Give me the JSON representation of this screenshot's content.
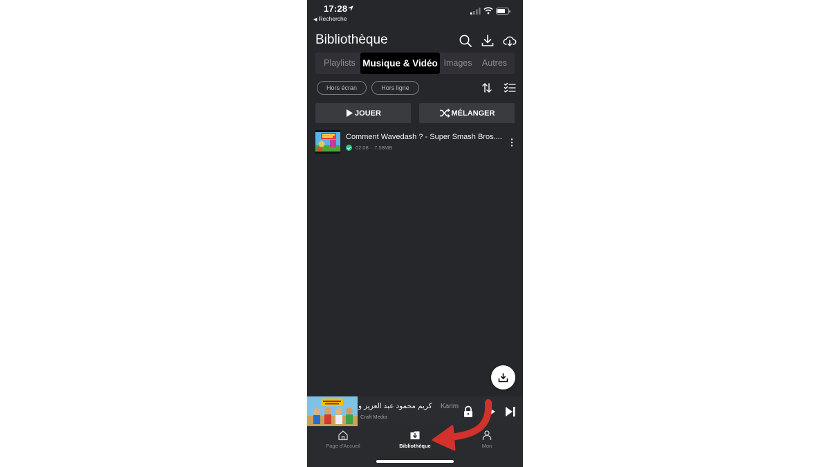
{
  "status_bar": {
    "time": "17:28",
    "back_label": "Recherche"
  },
  "header": {
    "title": "Bibliothèque"
  },
  "tabs": [
    {
      "label": "Playlists",
      "active": false
    },
    {
      "label": "Musique & Vidéo",
      "active": true
    },
    {
      "label": "Images",
      "active": false
    },
    {
      "label": "Autres",
      "active": false
    }
  ],
  "filters": [
    {
      "label": "Hors écran"
    },
    {
      "label": "Hors ligne"
    }
  ],
  "actions": {
    "play_label": "JOUER",
    "shuffle_label": "MÉLANGER"
  },
  "items": [
    {
      "title": "Comment Wavedash ? - Super Smash Bros....",
      "duration": "02:08",
      "size": "7.58MB",
      "downloaded": true
    }
  ],
  "mini_player": {
    "title_arabic": "كريم محمود عبد العزيز و",
    "title_latin": "Karim",
    "artist": "Craft Media"
  },
  "tab_bar": [
    {
      "label": "Page d'Accueil",
      "icon": "home-icon",
      "active": false
    },
    {
      "label": "Bibliothèque",
      "icon": "library-download-icon",
      "active": true
    },
    {
      "label": "Mon",
      "icon": "person-icon",
      "active": false
    }
  ],
  "colors": {
    "background": "#26272b",
    "accent_check": "#2dbf8c",
    "annotation_arrow": "#d3312b"
  }
}
